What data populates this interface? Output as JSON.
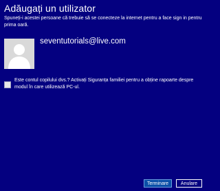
{
  "dialog": {
    "title": "Adăugați un utilizator",
    "description": "Spuneți-i acestei persoane că trebuie să se conecteze la internet pentru a face sign in pentru prima oară."
  },
  "account": {
    "email": "seventutorials@live.com",
    "avatar_icon": "user-silhouette-icon"
  },
  "child_option": {
    "checked": false,
    "label": "Este contul copilului dvs.? Activați Siguranța familiei pentru a obține rapoarte despre modul în care utilizează PC-ul."
  },
  "buttons": {
    "finish": "Terminare",
    "cancel": "Anulare"
  },
  "colors": {
    "background": "#040080",
    "primary_button": "#0a4fa8",
    "text": "#ffffff"
  }
}
